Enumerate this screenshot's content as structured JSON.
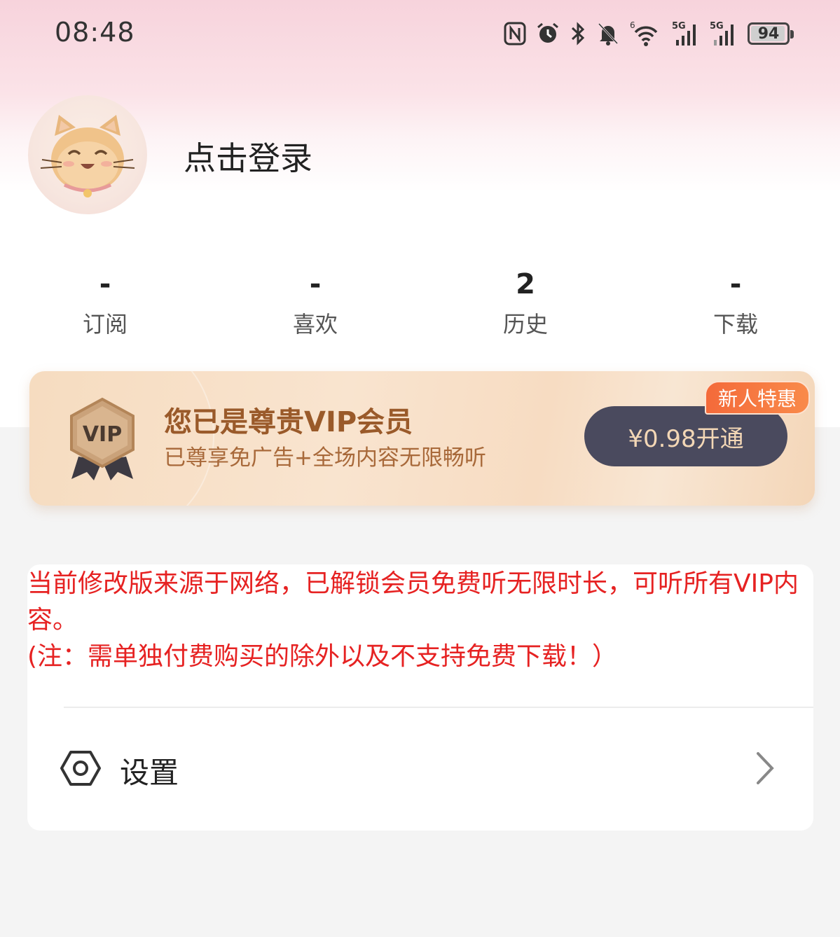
{
  "status_bar": {
    "time": "08:48",
    "icons": [
      "nfc-icon",
      "alarm-icon",
      "bluetooth-icon",
      "mute-icon",
      "wifi-icon",
      "signal-5g-icon",
      "signal-5g-2-icon"
    ],
    "wifi_label": "6",
    "network_1": "5G",
    "network_2": "5G",
    "battery": "94"
  },
  "profile": {
    "avatar": "cat-avatar",
    "login_text": "点击登录"
  },
  "stats": [
    {
      "value": "-",
      "label": "订阅"
    },
    {
      "value": "-",
      "label": "喜欢"
    },
    {
      "value": "2",
      "label": "历史"
    },
    {
      "value": "-",
      "label": "下载"
    }
  ],
  "vip": {
    "badge_text": "VIP",
    "title": "您已是尊贵VIP会员",
    "subtitle": "已尊享免广告+全场内容无限畅听",
    "button": "¥0.98开通",
    "tag": "新人特惠"
  },
  "notice": {
    "line1": "当前修改版来源于网络，已解锁会员免费听无限时长，可听所有VIP内容。",
    "line2": "(注：需单独付费购买的除外以及不支持免费下载！）"
  },
  "settings": {
    "label": "设置",
    "icon": "hexagon-settings-icon"
  }
}
